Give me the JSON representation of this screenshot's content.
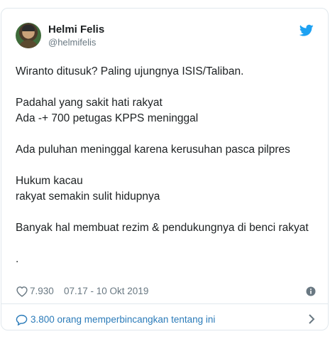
{
  "author": {
    "display_name": "Helmi Felis",
    "handle": "@helmifelis"
  },
  "tweet": {
    "text": "Wiranto ditusuk? Paling ujungnya ISIS/Taliban.\n\nPadahal yang sakit hati rakyat\nAda -+ 700 petugas KPPS meninggal\n\nAda puluhan meninggal karena kerusuhan pasca pilpres\n\nHukum kacau\nrakyat semakin sulit hidupnya\n\nBanyak hal membuat rezim & pendukungnya di benci rakyat\n\n."
  },
  "meta": {
    "like_count": "7.930",
    "timestamp": "07.17 - 10 Okt 2019"
  },
  "footer": {
    "conversation_label": "3.800 orang memperbincangkan tentang ini"
  },
  "icons": {
    "brand": "twitter-bird-icon",
    "like": "heart-icon",
    "info": "info-icon",
    "conversation": "speech-bubble-icon",
    "more": "chevron-right-icon"
  },
  "colors": {
    "twitter_blue": "#1da1f2",
    "link_blue": "#2b7bb9",
    "muted_text": "#697882",
    "border": "#e1e8ed"
  }
}
